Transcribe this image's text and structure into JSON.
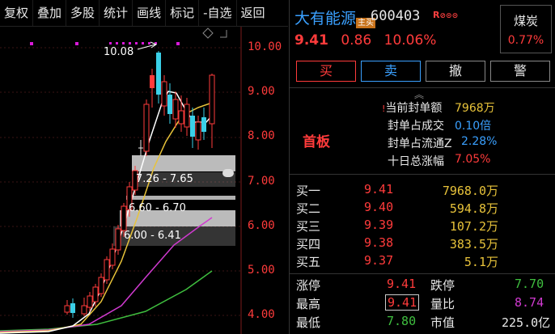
{
  "toolbar": {
    "items": [
      "复权",
      "叠加",
      "多股",
      "统计",
      "画线",
      "标记",
      "-自选",
      "返回"
    ]
  },
  "chart": {
    "y_ticks": [
      "10.00",
      "9.00",
      "8.00",
      "7.00",
      "6.00",
      "5.00",
      "4.00"
    ],
    "high_label": "10.08",
    "ranges": [
      "7.26 - 7.65",
      "6.60 - 6.70",
      "6.00 - 6.41"
    ]
  },
  "stock": {
    "name": "大有能源",
    "code": "600403",
    "badge": "主买",
    "rz": "R",
    "price": "9.41",
    "change": "0.86",
    "change_pct": "10.06%"
  },
  "sector": {
    "name": "煤炭",
    "pct": "0.77%"
  },
  "trade_buttons": {
    "buy": "买",
    "sell": "卖",
    "cancel": "撤",
    "alert": "警"
  },
  "seal": {
    "prefix": "!",
    "shouban": "首板",
    "rows": [
      {
        "label": "当前封单额",
        "value": "7968万",
        "color": "#e8c33a"
      },
      {
        "label": "封单占成交",
        "value": "0.10倍",
        "color": "#3aa0ff"
      },
      {
        "label": "封单占流通Z",
        "value": "2.28%",
        "color": "#3aa0ff"
      },
      {
        "label": "十日总涨幅",
        "value": "7.05%",
        "color": "#ff3b3b"
      }
    ]
  },
  "order_book": [
    {
      "label": "买一",
      "price": "9.41",
      "volume": "7968.0万"
    },
    {
      "label": "买二",
      "price": "9.40",
      "volume": "594.8万"
    },
    {
      "label": "买三",
      "price": "9.39",
      "volume": "107.2万"
    },
    {
      "label": "买四",
      "price": "9.38",
      "volume": "383.5万"
    },
    {
      "label": "买五",
      "price": "9.37",
      "volume": "5.1万"
    }
  ],
  "stats": {
    "limit_up_label": "涨停",
    "limit_up": "9.41",
    "limit_down_label": "跌停",
    "limit_down": "7.70",
    "high_label": "最高",
    "high": "9.41",
    "vol_ratio_label": "量比",
    "vol_ratio": "8.74",
    "low_label": "最低",
    "low": "7.80",
    "mkt_cap_label": "市值",
    "mkt_cap": "225.0亿"
  }
}
